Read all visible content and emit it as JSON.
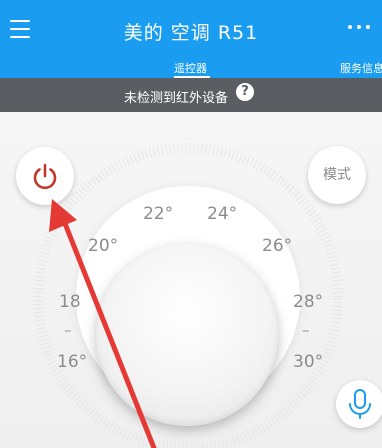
{
  "header": {
    "title": "美的 空调 R51",
    "tabs": {
      "remote": "遥控器",
      "service": "服务信息"
    }
  },
  "status": {
    "message": "未检测到红外设备",
    "help_glyph": "?"
  },
  "controls": {
    "mode_label": "模式"
  },
  "temperatures": {
    "t16": "16°",
    "t18": "18",
    "t20": "20°",
    "t22": "22°",
    "t24": "24°",
    "t26": "26°",
    "t28": "28°",
    "t30": "30°"
  },
  "separators": {
    "left": "–",
    "right": "–"
  },
  "icons": {
    "menu": "menu-icon",
    "more": "more-icon",
    "help": "help-icon",
    "power": "power-icon",
    "microphone": "microphone-icon",
    "annotation": "arrow-annotation"
  },
  "colors": {
    "header": "#1a9cf0",
    "status_bar": "#5a5e62",
    "power": "#c0392b",
    "microphone": "#1a9cf0",
    "arrow": "#e53935"
  }
}
